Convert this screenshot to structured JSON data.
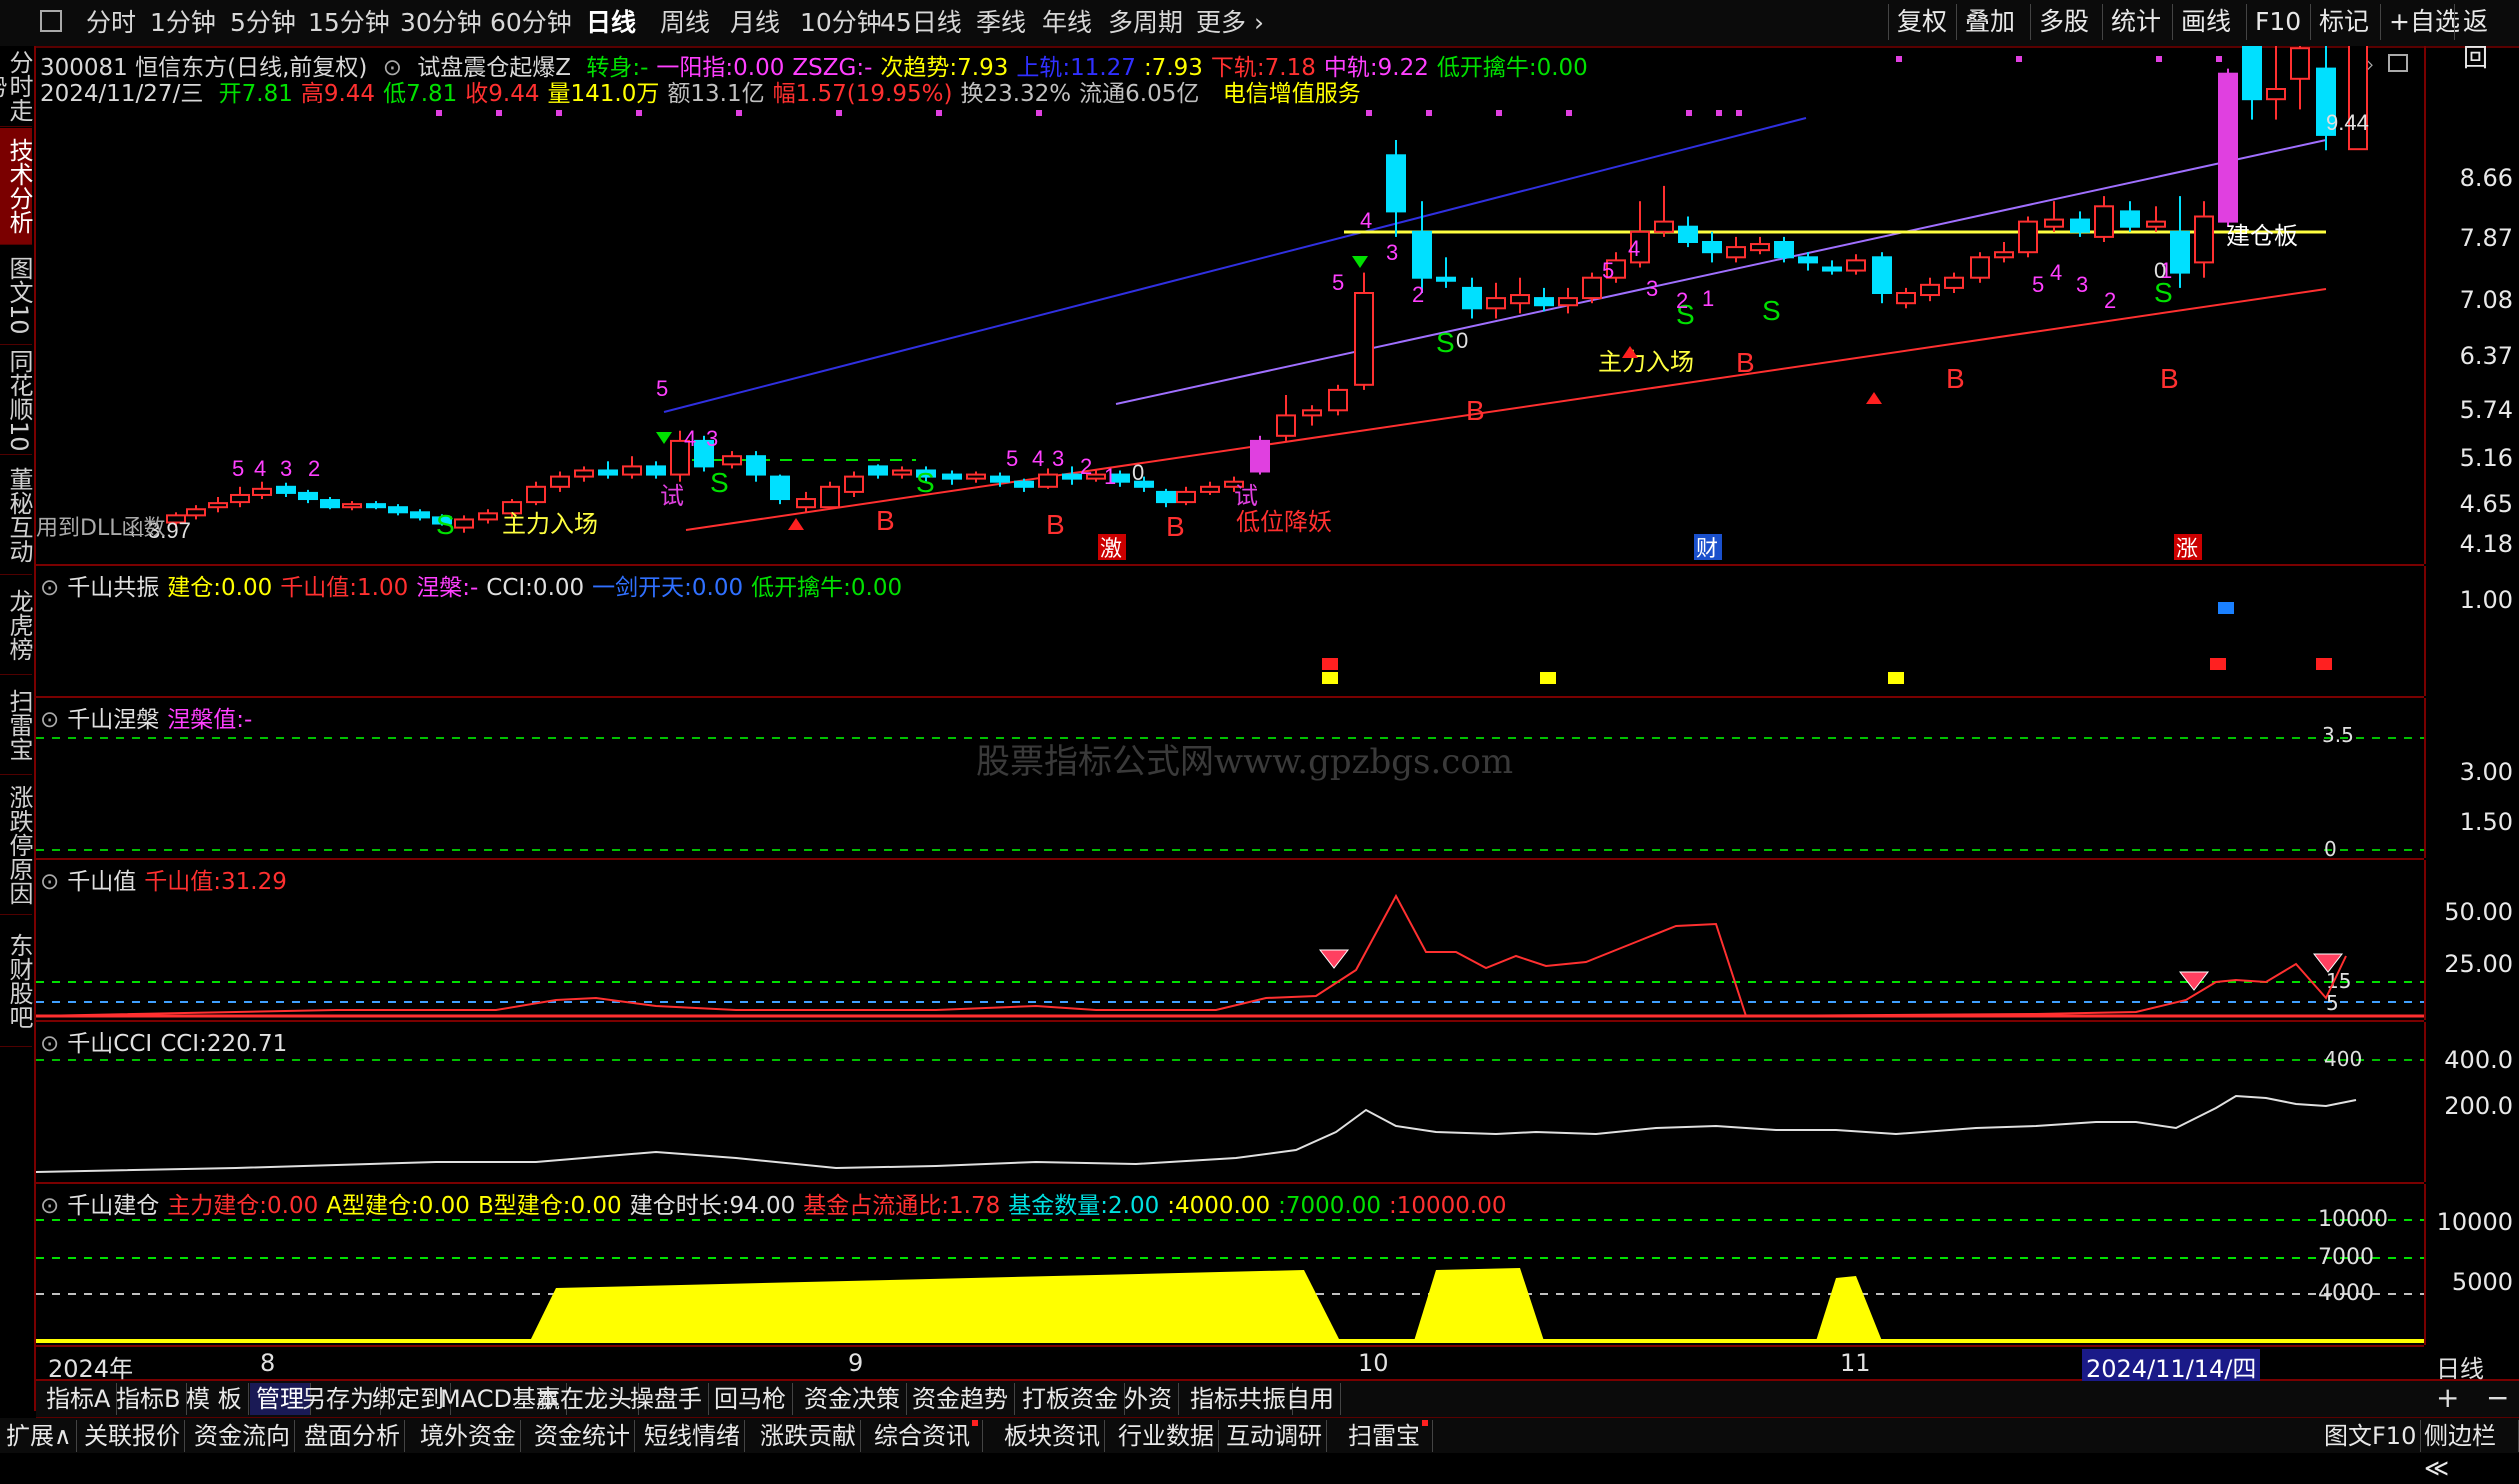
{
  "toolbar": {
    "periods": [
      "分时",
      "1分钟",
      "5分钟",
      "15分钟",
      "30分钟",
      "60分钟",
      "日线",
      "周线",
      "月线",
      "10分钟",
      "45日线",
      "季线",
      "年线",
      "多周期",
      "更多"
    ],
    "active_period": "日线",
    "right": [
      "复权",
      "叠加",
      "多股",
      "统计",
      "画线",
      "F10",
      "标记",
      "+自选",
      "返回"
    ]
  },
  "sidebar": {
    "tabs": [
      "分时走势",
      "技术分析",
      "图文10",
      "同花顺10",
      "董秘互动",
      "龙虎榜",
      "扫雷宝",
      "涨跌停原因",
      "东财股吧"
    ],
    "active": "技术分析"
  },
  "main_info": {
    "line1": {
      "code_name": "300081 恒信东方(日线,前复权)",
      "indicator": "试盘震仓起爆Z",
      "items": [
        {
          "label": "转身:",
          "value": "-",
          "color": "#00e000"
        },
        {
          "label": "一阳指:",
          "value": "0.00",
          "color": "#ff40ff"
        },
        {
          "label": "ZSZG:",
          "value": "-",
          "color": "#ff40ff"
        },
        {
          "label": "次趋势:",
          "value": "7.93",
          "color": "#ffff00"
        },
        {
          "label": "上轨:",
          "value": "11.27",
          "color": "#3030ff"
        },
        {
          "label": ":",
          "value": "7.93",
          "color": "#ffff00"
        },
        {
          "label": "下轨:",
          "value": "7.18",
          "color": "#ff3030"
        },
        {
          "label": "中轨:",
          "value": "9.22",
          "color": "#ff40ff"
        },
        {
          "label": "低开擒牛:",
          "value": "0.00",
          "color": "#00e000"
        }
      ]
    },
    "line2": {
      "date": "2024/11/27/三",
      "items": [
        {
          "label": "开",
          "value": "7.81",
          "color": "#00e000"
        },
        {
          "label": "高",
          "value": "9.44",
          "color": "#ff3030"
        },
        {
          "label": "低",
          "value": "7.81",
          "color": "#00e000"
        },
        {
          "label": "收",
          "value": "9.44",
          "color": "#ff3030"
        },
        {
          "label": "量",
          "value": "141.0万",
          "color": "#ffff00"
        },
        {
          "label": "额",
          "value": "13.1亿",
          "color": "#c0c0c0"
        },
        {
          "label": "幅",
          "value": "1.57(19.95%)",
          "color": "#ff3030"
        },
        {
          "label": "换",
          "value": "23.32%",
          "color": "#c0c0c0"
        },
        {
          "label": "流通",
          "value": "6.05亿",
          "color": "#c0c0c0"
        }
      ],
      "tag": "电信增值服务"
    },
    "y_labels": [
      "8.66",
      "7.87",
      "7.08",
      "6.37",
      "5.74",
      "5.16",
      "4.65",
      "4.18"
    ],
    "annotations": {
      "high_label": "9.44",
      "low_label": "3.97",
      "jiancang_board": "建仓板",
      "main_force_1": "主力入场",
      "main_force_2": "主力入场",
      "low_pos": "低位降妖",
      "dll_msg": "用到DLL函数",
      "shi": "试",
      "badge_ji": "激",
      "badge_cai": "财",
      "badge_zhang": "涨"
    }
  },
  "panel_gongzhen": {
    "title": "千山共振",
    "items": [
      {
        "label": "建仓:",
        "value": "0.00",
        "color": "#ffff00"
      },
      {
        "label": "千山值:",
        "value": "1.00",
        "color": "#ff3030"
      },
      {
        "label": "涅槃:",
        "value": "-",
        "color": "#ff40ff"
      },
      {
        "label": "CCI:",
        "value": "0.00",
        "color": "#e0e0e0"
      },
      {
        "label": "一剑开天:",
        "value": "0.00",
        "color": "#3070ff"
      },
      {
        "label": "低开擒牛:",
        "value": "0.00",
        "color": "#00e000"
      }
    ],
    "y_labels": [
      "1.00"
    ]
  },
  "panel_niepan": {
    "title": "千山涅槃",
    "items": [
      {
        "label": "涅槃值:",
        "value": "-",
        "color": "#ff40ff"
      }
    ],
    "y_labels": [
      "3.00",
      "1.50"
    ],
    "line_labels": [
      "3.5",
      "0"
    ],
    "watermark": "股票指标公式网www.gpzbgs.com"
  },
  "panel_qianshan": {
    "title": "千山值",
    "items": [
      {
        "label": "千山值:",
        "value": "31.29",
        "color": "#ff3030"
      }
    ],
    "y_labels": [
      "50.00",
      "25.00"
    ],
    "line_labels": [
      "15",
      "5"
    ]
  },
  "panel_cci": {
    "title": "千山CCI",
    "items": [
      {
        "label": "CCI:",
        "value": "220.71",
        "color": "#e0e0e0"
      }
    ],
    "y_labels": [
      "400.0",
      "200.0"
    ],
    "line_labels": [
      "400"
    ]
  },
  "panel_jiancang": {
    "title": "千山建仓",
    "items": [
      {
        "label": "主力建仓:",
        "value": "0.00",
        "color": "#ff3030"
      },
      {
        "label": "A型建仓:",
        "value": "0.00",
        "color": "#ffff00"
      },
      {
        "label": "B型建仓:",
        "value": "0.00",
        "color": "#ffff00"
      },
      {
        "label": "建仓时长:",
        "value": "94.00",
        "color": "#e0e0e0"
      },
      {
        "label": "基金占流通比:",
        "value": "1.78",
        "color": "#ff3030"
      },
      {
        "label": "基金数量:",
        "value": "2.00",
        "color": "#00e0e0"
      },
      {
        "label": ":",
        "value": "4000.00",
        "color": "#ffff00"
      },
      {
        "label": ":",
        "value": "7000.00",
        "color": "#00e000"
      },
      {
        "label": ":",
        "value": "10000.00",
        "color": "#ff3030"
      }
    ],
    "y_labels": [
      "10000",
      "5000"
    ],
    "line_labels": [
      "10000",
      "7000",
      "4000"
    ]
  },
  "x_axis": {
    "labels": [
      "2024年",
      "8",
      "9",
      "10",
      "11"
    ],
    "cursor_date": "2024/11/14/四",
    "period": "日线"
  },
  "bottom_tabs": [
    "指标A",
    "指标B",
    "模 板",
    "管理",
    "另存为",
    "绑定到",
    "MACD基本",
    "赢在龙头",
    "操盘手",
    "回马枪",
    "资金决策",
    "资金趋势",
    "打板资金",
    "外资",
    "指标共振",
    "自用"
  ],
  "bottom_active": "管理",
  "status_tabs": [
    "扩展∧",
    "关联报价",
    "资金流向",
    "盘面分析",
    "境外资金",
    "资金统计",
    "短线情绪",
    "涨跌贡献",
    "综合资讯",
    "板块资讯",
    "行业数据",
    "互动调研",
    "扫雷宝"
  ],
  "status_right": [
    "图文F10",
    "侧边栏≪"
  ],
  "colors": {
    "up": "#ff3030",
    "down": "#00e0ff",
    "bg": "#000000",
    "border": "#7a0000"
  }
}
